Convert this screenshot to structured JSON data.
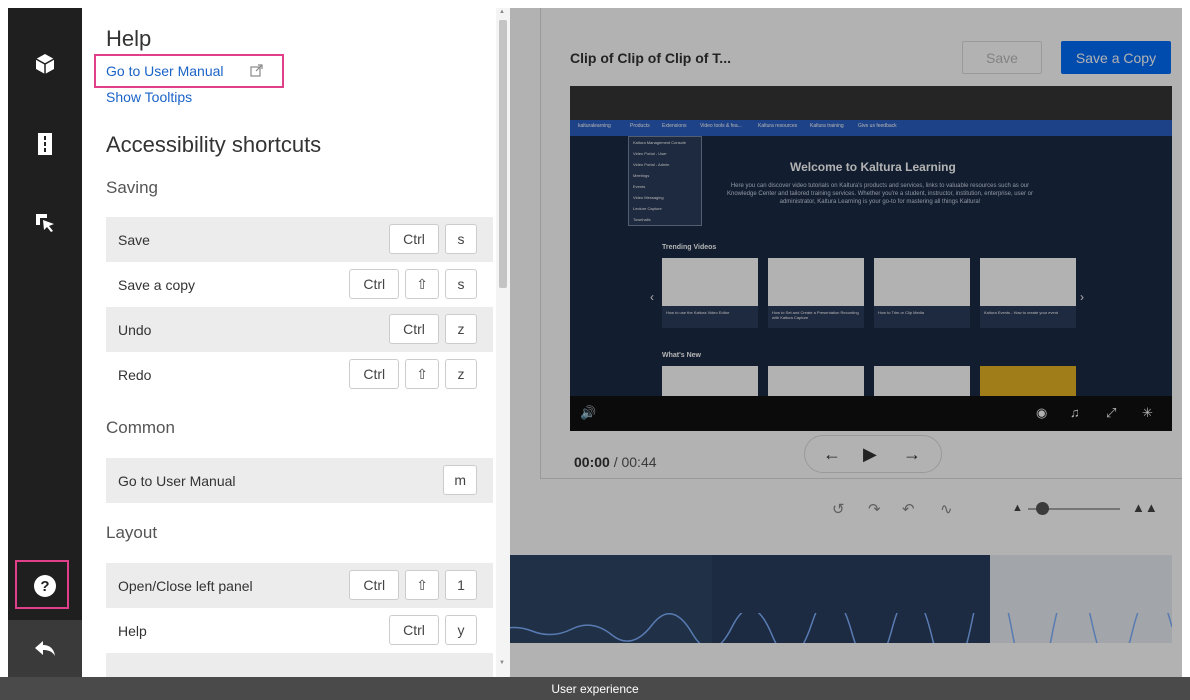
{
  "help_panel": {
    "title": "Help",
    "manual_link": "Go to User Manual",
    "tooltips_link": "Show Tooltips",
    "section_title": "Accessibility shortcuts",
    "groups": [
      {
        "title": "Saving",
        "rows": [
          {
            "label": "Save",
            "keys": [
              "Ctrl",
              "s"
            ]
          },
          {
            "label": "Save a copy",
            "keys": [
              "Ctrl",
              "⇧",
              "s"
            ]
          },
          {
            "label": "Undo",
            "keys": [
              "Ctrl",
              "z"
            ]
          },
          {
            "label": "Redo",
            "keys": [
              "Ctrl",
              "⇧",
              "z"
            ]
          }
        ]
      },
      {
        "title": "Common",
        "rows": [
          {
            "label": "Go to User Manual",
            "keys": [
              "m"
            ]
          }
        ]
      },
      {
        "title": "Layout",
        "rows": [
          {
            "label": "Open/Close left panel",
            "keys": [
              "Ctrl",
              "⇧",
              "1"
            ]
          },
          {
            "label": "Help",
            "keys": [
              "Ctrl",
              "y"
            ]
          }
        ]
      }
    ]
  },
  "editor": {
    "clip_title": "Clip of Clip of Clip of T...",
    "save_label": "Save",
    "save_copy_label": "Save a Copy",
    "current_time": "00:00",
    "time_separator": "/",
    "duration": "00:44"
  },
  "player_content": {
    "nav_items": [
      "kalturalearning",
      "Products",
      "Extensions",
      "Video tools & fea...",
      "Kaltura resources",
      "Kaltura training",
      "Give us feedback"
    ],
    "heading": "Welcome to Kaltura Learning",
    "intro": "Here you can discover video tutorials on Kaltura's products and services, links to valuable resources such as our Knowledge Center and tailored training services. Whether you're a student, instructor, institution, enterprise, user or administrator, Kaltura Learning is your go-to for mastering all things Kaltura!",
    "dropdown": [
      "Kaltura Management Console",
      "Video Portal - User",
      "Video Portal - Admin",
      "Meetings",
      "Events",
      "Video Messaging",
      "Lecture Capture",
      "Townhalls"
    ],
    "trending": "Trending Videos",
    "whats_new": "What's New",
    "thumb_captions": [
      "How to use the Kaltura Video Editor",
      "How to Set and Create a Presentation Recording with Kaltura Capture",
      "How to Trim or Clip Media",
      "Kaltura Events - How to create your event"
    ]
  },
  "footer": {
    "label": "User experience"
  },
  "colors": {
    "accent": "#006efa",
    "highlight": "#e0408a",
    "link": "#1a63c7",
    "rail": "#1f1f1f"
  }
}
